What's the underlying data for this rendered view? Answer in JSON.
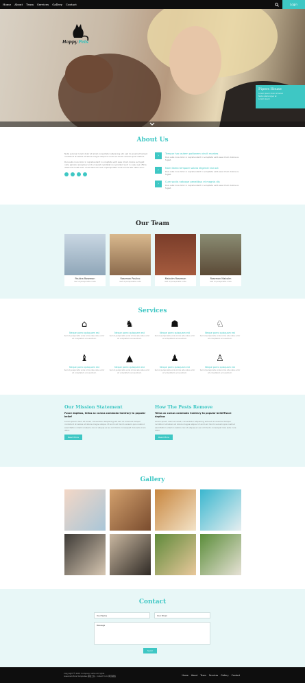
{
  "nav": {
    "items": [
      "Home",
      "About",
      "Team",
      "Services",
      "Gallery",
      "Contact"
    ],
    "login_label": "Login"
  },
  "hero": {
    "brand_first": "Happy",
    "brand_second": "Pets",
    "promo": {
      "title": "Pipers House",
      "lines": [
        "Lorem ipsum dolor sit amet",
        "Nulla ullamcorper et",
        "Lorem ipsum"
      ]
    }
  },
  "about": {
    "title": "About Us",
    "paragraphs": [
      "Nulla pulvinar lorem dolor sit amet consectetur adipiscing elit, sed do eiusmod tempor incididunt ut labore et dolore magna aliqua ut enim ad minim veniam quis nostrud.",
      "Duis aute irure dolor in reprehenderit in voluptate velit esse cillum dolore eu fugiat nulla pariatur excepteur sint occaecat cupidatat non proident sunt in culpa qui officia deserunt mollit anim id est laborum sed ut perspiciatis unde omnis iste natus error."
    ],
    "features": [
      {
        "title": "Tempor hac autem potionem vincit montes",
        "text": "Duis aute irure dolor in reprehenderit in voluptate velit esse cillum dolore eu fugiat."
      },
      {
        "title": "Nam libero tempore soluta eligendi nisi aut",
        "text": "Duis aute irure dolor in reprehenderit in voluptate velit esse cillum dolore eu fugiat."
      },
      {
        "title": "Cum sociis natoque penatibus et magnis dis",
        "text": "Duis aute irure dolor in reprehenderit in voluptate velit esse cillum dolore eu fugiat."
      }
    ]
  },
  "team": {
    "title": "Our Team",
    "members": [
      {
        "name": "Paulina Roseman",
        "role": "Sed ut perspiciatis unde"
      },
      {
        "name": "Roseman Paulino",
        "role": "Sed ut perspiciatis unde"
      },
      {
        "name": "Malcolm Roseman",
        "role": "Sed ut perspiciatis unde"
      },
      {
        "name": "Roseman Malcolm",
        "role": "Sed ut perspiciatis unde"
      }
    ]
  },
  "services": {
    "title": "Services",
    "items": [
      {
        "icon": "house-icon",
        "title": "Neque porro quisquam est",
        "text": "Sed ut perspiciatis unde omnis iste natus error sit voluptatem accusantium."
      },
      {
        "icon": "person-dog-icon",
        "title": "Neque porro quisquam est",
        "text": "Sed ut perspiciatis unde omnis iste natus error sit voluptatem accusantium."
      },
      {
        "icon": "cat-icon",
        "title": "Neque porro quisquam est",
        "text": "Sed ut perspiciatis unde omnis iste natus error sit voluptatem accusantium."
      },
      {
        "icon": "walking-dog-icon",
        "title": "Neque porro quisquam est",
        "text": "Sed ut perspiciatis unde omnis iste natus error sit voluptatem accusantium."
      },
      {
        "icon": "dog-trainer-icon",
        "title": "Neque porro quisquam est",
        "text": "Sed ut perspiciatis unde omnis iste natus error sit voluptatem accusantium."
      },
      {
        "icon": "pet-house-icon",
        "title": "Neque porro quisquam est",
        "text": "Sed ut perspiciatis unde omnis iste natus error sit voluptatem accusantium."
      },
      {
        "icon": "dog-head-icon",
        "title": "Neque porro quisquam est",
        "text": "Sed ut perspiciatis unde omnis iste natus error sit voluptatem accusantium."
      },
      {
        "icon": "dog-walker-icon",
        "title": "Neque porro quisquam est",
        "text": "Sed ut perspiciatis unde omnis iste natus error sit voluptatem accusantium."
      }
    ]
  },
  "mission": {
    "left": {
      "title": "Our Mission Statement",
      "subtitle": "Fusce dapibus, tellus ac cursus commodo Contrary to popular belief",
      "text": "Lorem ipsum dolor sit amet, consectetur adipiscing elit sed do eiusmod tempor incididunt ut labore et dolore magna aliqua. Ut enim ad minim veniam quis nostrud exercitation ullamco laboris nisi ut aliquip ex ea commodo consequat duis aute irure dolor.",
      "button": "Read More"
    },
    "right": {
      "title": "How The Pests Remove",
      "subtitle": "Tellus ac cursus commodo Contrary to popular beliefFusce dapibus",
      "text": "Lorem ipsum dolor sit amet, consectetur adipiscing elit sed do eiusmod tempor incididunt ut labore et dolore magna aliqua. Ut enim ad minim veniam quis nostrud exercitation ullamco laboris nisi ut aliquip ex ea commodo consequat duis aute irure dolor.",
      "button": "Read More"
    }
  },
  "gallery": {
    "title": "Gallery",
    "images": [
      "girl-with-cat",
      "girl-with-dog",
      "puppy-on-grass",
      "husky-in-pool",
      "kittens",
      "women-with-dobermans",
      "woman-with-dog",
      "dogs-on-lawn"
    ]
  },
  "contact": {
    "title": "Contact",
    "name_placeholder": "Your Name",
    "email_placeholder": "Your Email",
    "message_placeholder": "Message",
    "submit_label": "Send"
  },
  "footer": {
    "copy_line1": "Copyright © 2015 Company name All rights",
    "copy_line2": "reserved.More Templates 模板之家 - Collect from 网页模板",
    "nav": [
      "Home",
      "About",
      "Team",
      "Services",
      "Gallery",
      "Contact"
    ]
  },
  "colors": {
    "accent": "#3ec7c4",
    "dark": "#0e0e0e",
    "band": "#e8f7f7"
  }
}
